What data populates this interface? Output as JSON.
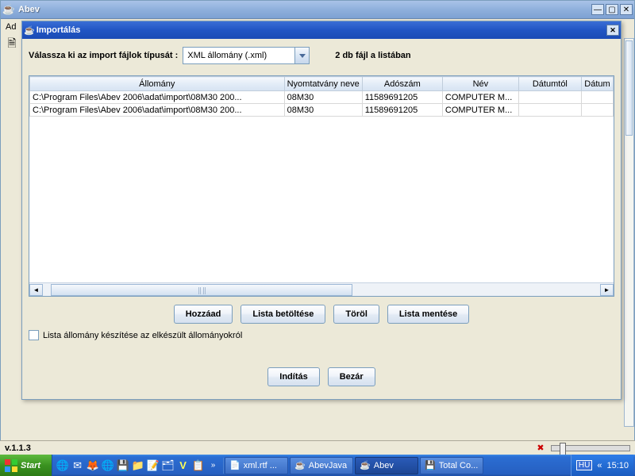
{
  "main_window": {
    "title": "Abev",
    "menubar": {
      "item0": "Ad"
    }
  },
  "dialog": {
    "title": "Importálás",
    "filter_label": "Válassza ki az import fájlok típusát :",
    "filter_combo": "XML állomány (.xml)",
    "count_label": "2 db fájl a listában",
    "columns": {
      "c0": "Állomány",
      "c1": "Nyomtatvány neve",
      "c2": "Adószám",
      "c3": "Név",
      "c4": "Dátumtól",
      "c5": "Dátum"
    },
    "rows": [
      {
        "c0": "C:\\Program Files\\Abev 2006\\adat\\import\\08M30 200...",
        "c1": "08M30",
        "c2": "11589691205",
        "c3": "COMPUTER M...",
        "c4": "",
        "c5": ""
      },
      {
        "c0": "C:\\Program Files\\Abev 2006\\adat\\import\\08M30 200...",
        "c1": "08M30",
        "c2": "11589691205",
        "c3": "COMPUTER M...",
        "c4": "",
        "c5": ""
      }
    ],
    "buttons": {
      "add": "Hozzáad",
      "load": "Lista betöltése",
      "delete": "Töröl",
      "save": "Lista mentése",
      "start": "Indítás",
      "close": "Bezár"
    },
    "checkbox_label": "Lista állomány készítése az elkészült állományokról"
  },
  "statusbar": {
    "version": "v.1.1.3"
  },
  "taskbar": {
    "start": "Start",
    "items": [
      {
        "icon": "📄",
        "label": "xml.rtf ..."
      },
      {
        "icon": "☕",
        "label": "AbevJava"
      },
      {
        "icon": "☕",
        "label": "Abev"
      },
      {
        "icon": "💾",
        "label": "Total Co..."
      }
    ],
    "tray_icons": [
      "HU",
      "«"
    ],
    "clock": "15:10"
  }
}
